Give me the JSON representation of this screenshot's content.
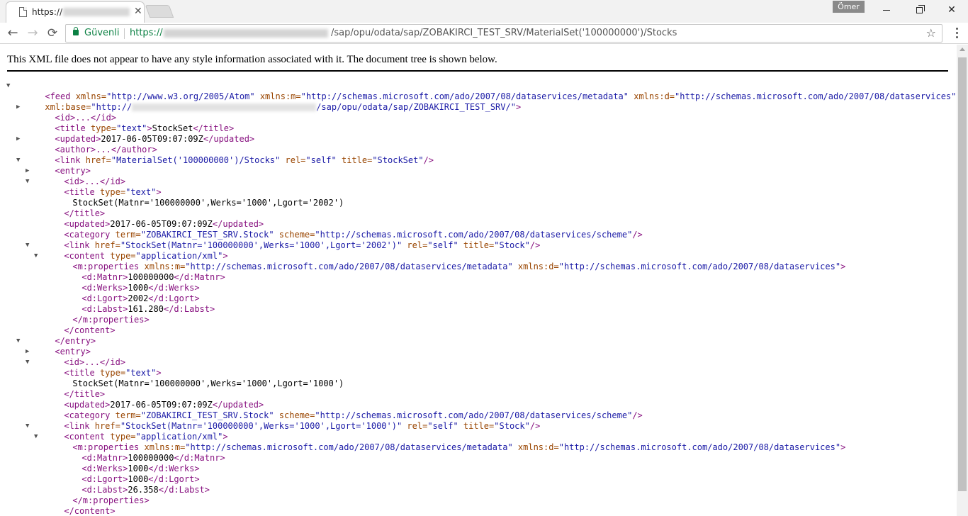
{
  "browser": {
    "tab": {
      "title": "https://",
      "close_glyph": "✕"
    },
    "profile_name": "Ömer",
    "window_controls": {
      "close_glyph": "✕"
    },
    "nav": {
      "back_glyph": "←",
      "forward_glyph": "→",
      "reload_glyph": "⟳"
    },
    "omnibox": {
      "secure_label": "Güvenli",
      "url_scheme": "https://",
      "url_path": "/sap/opu/odata/sap/ZOBAKIRCI_TEST_SRV/MaterialSet('100000000')/Stocks",
      "star_glyph": "☆"
    },
    "icons": [
      "page-icon",
      "lock-icon",
      "star-icon",
      "menu-icon",
      "back-arrow-icon",
      "forward-arrow-icon",
      "reload-icon"
    ]
  },
  "viewer": {
    "notice": "This XML file does not appear to have any style information associated with it. The document tree is shown below.",
    "colors": {
      "tag": "#881280",
      "attr_name": "#994500",
      "attr_value": "#1a1aa6",
      "secure": "#0b8043"
    }
  },
  "xml": {
    "feed_open_1a": "<feed ",
    "feed_open_1b": "xmlns=",
    "feed_open_1c": "\"http://www.w3.org/2005/Atom\"",
    "feed_open_1d": " xmlns:m=",
    "feed_open_1e": "\"http://schemas.microsoft.com/ado/2007/08/dataservices/metadata\"",
    "feed_open_1f": " xmlns:d=",
    "feed_open_1g": "\"http://schemas.microsoft.com/ado/2007/08/dataservices\"",
    "feed_open_2a": "xml:base=",
    "feed_open_2b": "\"http://",
    "feed_open_2c": "/sap/opu/odata/sap/ZOBAKIRCI_TEST_SRV/\"",
    "feed_open_2d": ">",
    "id_collapsed": "<id>...</id>",
    "feed_title_open": "<title ",
    "type_attr": "type=",
    "text_val": "\"text\"",
    "feed_title_text": "StockSet",
    "title_close": "</title>",
    "updated_open": "<updated>",
    "updated_close": "</updated>",
    "feed_updated": "2017-06-05T09:07:09Z",
    "author_collapsed": "<author>...</author>",
    "link_open": "<link ",
    "href_attr": "href=",
    "feed_link_href": "\"MaterialSet('100000000')/Stocks\"",
    "rel_attr": " rel=",
    "self_val": "\"self\"",
    "title_attr": " title=",
    "feed_link_title": "\"StockSet\"",
    "selfclose": "/>",
    "entry_open": "<entry>",
    "entry_close": "</entry>",
    "gt": ">",
    "category_open": "<category ",
    "term_attr": "term=",
    "term_val": "\"ZOBAKIRCI_TEST_SRV.Stock\"",
    "scheme_attr": " scheme=",
    "scheme_val": "\"http://schemas.microsoft.com/ado/2007/08/dataservices/scheme\"",
    "entry_link_title": "\"Stock\"",
    "content_open": "<content ",
    "content_type_val": "\"application/xml\"",
    "content_close": "</content>",
    "props_open": "<m:properties ",
    "xmlns_m_attr": "xmlns:m=",
    "xmlns_m_val": "\"http://schemas.microsoft.com/ado/2007/08/dataservices/metadata\"",
    "xmlns_d_attr": " xmlns:d=",
    "xmlns_d_val": "\"http://schemas.microsoft.com/ado/2007/08/dataservices\"",
    "props_close": "</m:properties>",
    "matnr_open": "<d:Matnr>",
    "matnr_close": "</d:Matnr>",
    "werks_open": "<d:Werks>",
    "werks_close": "</d:Werks>",
    "lgort_open": "<d:Lgort>",
    "lgort_close": "</d:Lgort>",
    "labst_open": "<d:Labst>",
    "labst_close": "</d:Labst>",
    "entries": [
      {
        "title_text": "StockSet(Matnr='100000000',Werks='1000',Lgort='2002')",
        "updated": "2017-06-05T09:07:09Z",
        "link_href": "\"StockSet(Matnr='100000000',Werks='1000',Lgort='2002')\"",
        "matnr": "100000000",
        "werks": "1000",
        "lgort": "2002",
        "labst": "161.280"
      },
      {
        "title_text": "StockSet(Matnr='100000000',Werks='1000',Lgort='1000')",
        "updated": "2017-06-05T09:07:09Z",
        "link_href": "\"StockSet(Matnr='100000000',Werks='1000',Lgort='1000')\"",
        "matnr": "100000000",
        "werks": "1000",
        "lgort": "1000",
        "labst": "26.358"
      }
    ]
  }
}
